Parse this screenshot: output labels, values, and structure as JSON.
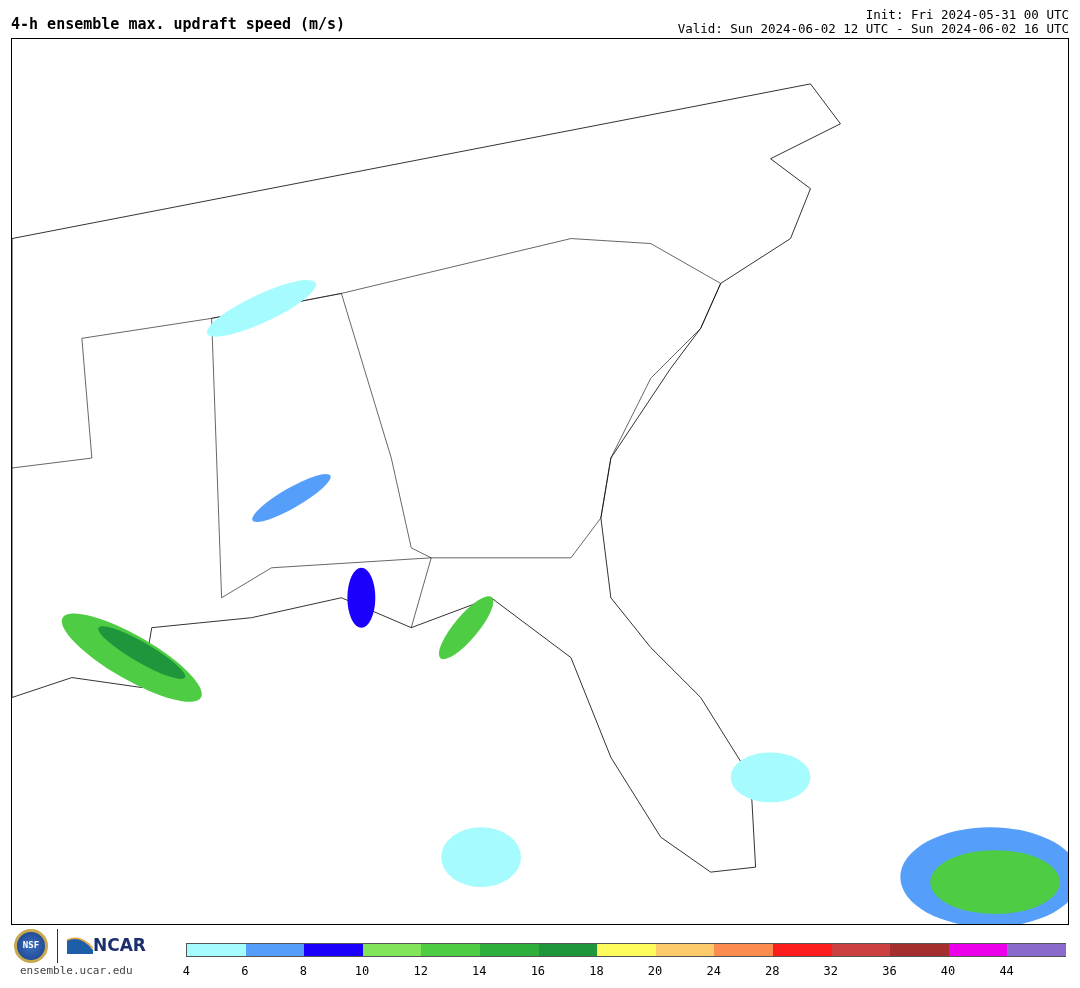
{
  "header": {
    "title": "4-h ensemble max. updraft speed (m/s)",
    "init": "Init: Fri 2024-05-31 00 UTC",
    "valid": "Valid: Sun 2024-06-02 12 UTC - Sun 2024-06-02 16 UTC"
  },
  "footer": {
    "nsf_text": "NSF",
    "ncar_text": "NCAR",
    "site": "ensemble.ucar.edu"
  },
  "colorbar": {
    "segments": [
      {
        "color": "#a5fbfd"
      },
      {
        "color": "#559ffb"
      },
      {
        "color": "#1b00fb"
      },
      {
        "color": "#81e55b"
      },
      {
        "color": "#4dcc44"
      },
      {
        "color": "#2eae3b"
      },
      {
        "color": "#1f963b"
      },
      {
        "color": "#fdfc5c"
      },
      {
        "color": "#fdcb6a"
      },
      {
        "color": "#fc8b4f"
      },
      {
        "color": "#fc1c1c"
      },
      {
        "color": "#cc4040"
      },
      {
        "color": "#a52e2e"
      },
      {
        "color": "#ec00ec"
      },
      {
        "color": "#8a6bcc"
      }
    ],
    "ticks": [
      "4",
      "6",
      "8",
      "10",
      "12",
      "14",
      "16",
      "18",
      "20",
      "24",
      "28",
      "32",
      "36",
      "40",
      "44"
    ]
  }
}
